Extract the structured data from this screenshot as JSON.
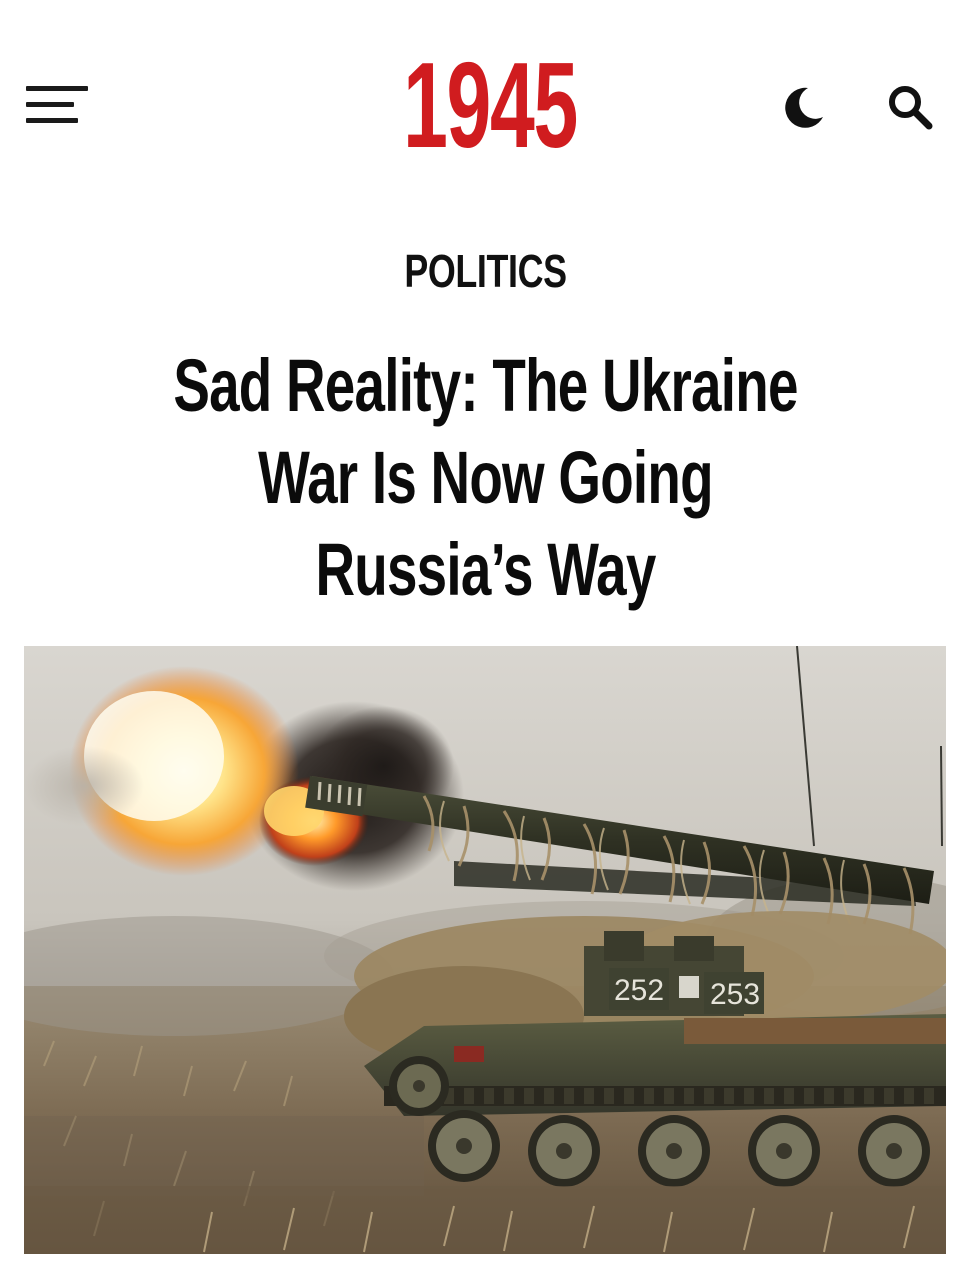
{
  "site": {
    "logo_text": "1945",
    "brand_color": "#d01c1f"
  },
  "header": {
    "menu_icon": "hamburger-menu-icon",
    "dark_mode_icon": "moon-icon",
    "search_icon": "search-icon"
  },
  "article": {
    "category": "POLITICS",
    "headline_lines": [
      "Sad Reality: The Ukraine",
      "War Is Now Going",
      "Russia’s Way"
    ]
  },
  "hero_image": {
    "vehicle_numbers": [
      "252",
      "253"
    ]
  }
}
